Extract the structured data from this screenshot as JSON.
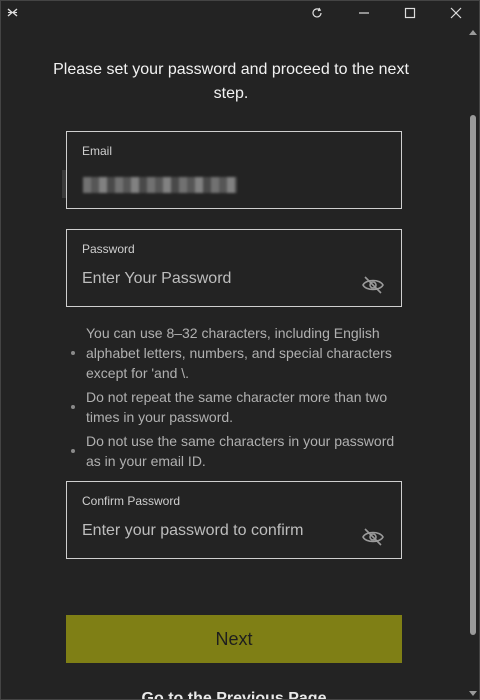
{
  "window": {
    "controls": [
      "refresh-icon",
      "minimize-icon",
      "maximize-icon",
      "close-icon"
    ]
  },
  "heading": "Please set your password and proceed to the next step.",
  "email": {
    "label": "Email",
    "value_obscured": true
  },
  "password": {
    "label": "Password",
    "placeholder": "Enter Your Password",
    "icon": "eye-off-icon"
  },
  "rules": [
    "You can use 8–32 characters, including English alphabet letters, numbers, and special characters except for 'and \\.",
    "Do not repeat the same character more than two times in your password.",
    "Do not use the same characters in your password as in your email ID."
  ],
  "confirm": {
    "label": "Confirm Password",
    "placeholder": "Enter your password to confirm",
    "icon": "eye-off-icon"
  },
  "actions": {
    "next_label": "Next",
    "previous_label": "Go to the Previous Page"
  },
  "colors": {
    "background": "#232323",
    "accent": "#7f7f15",
    "border": "#cfcfcf"
  }
}
